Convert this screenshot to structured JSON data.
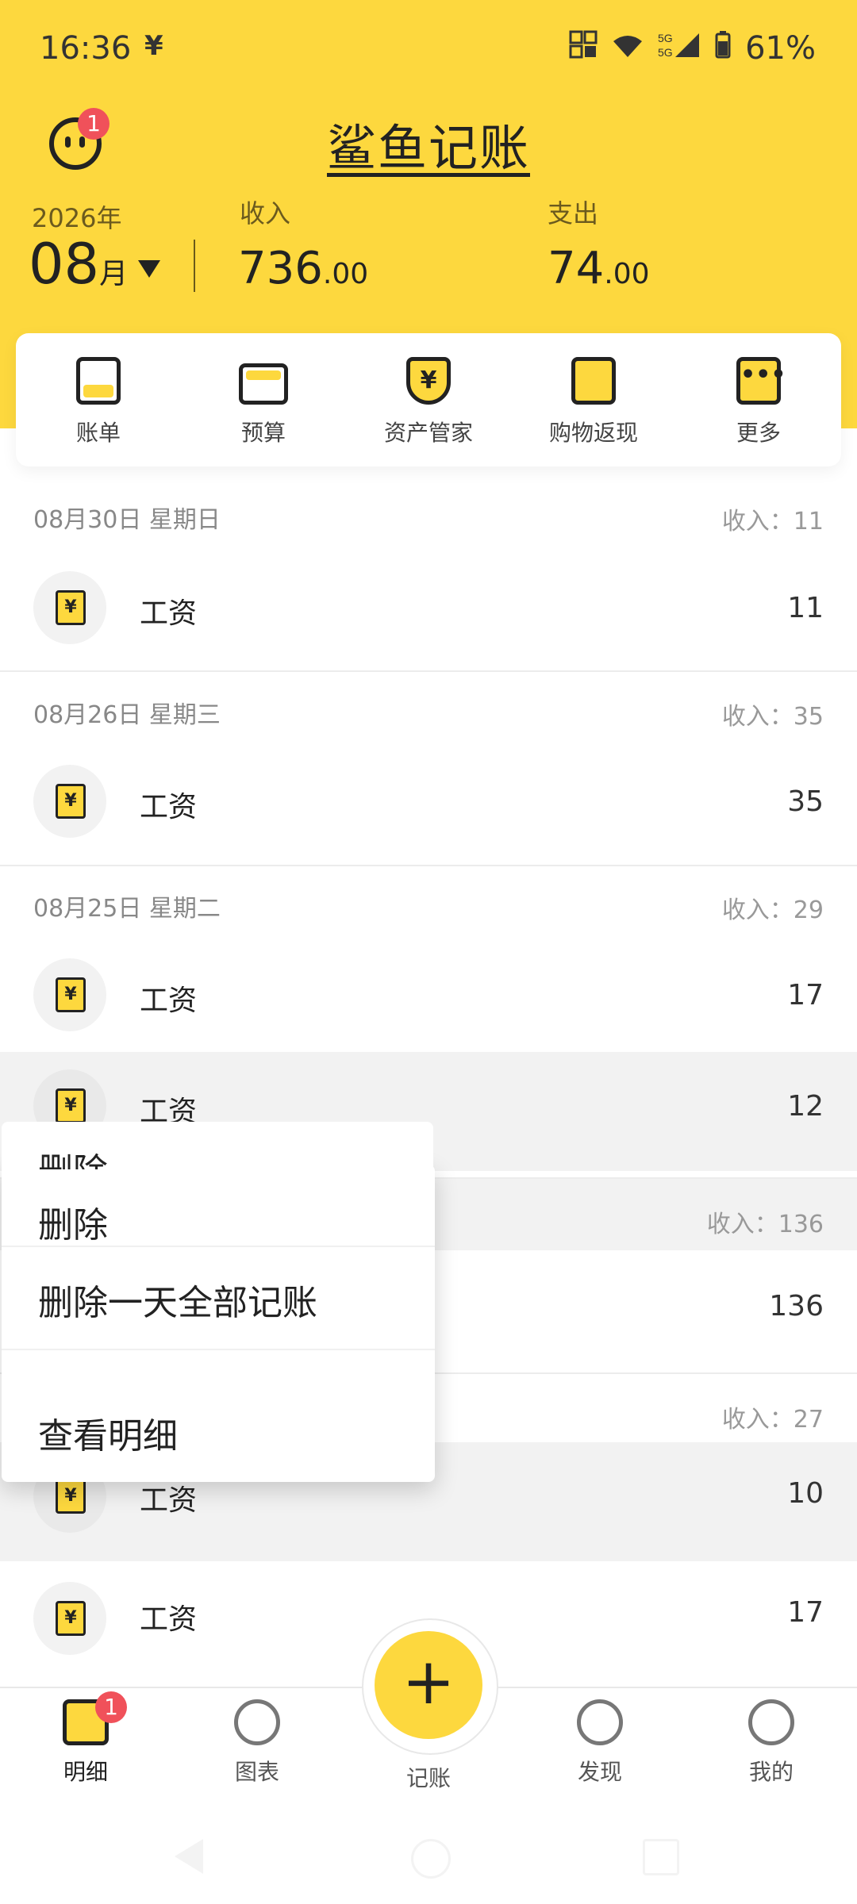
{
  "status_bar": {
    "time": "16:36",
    "yen_icon": "¥",
    "battery": "61%"
  },
  "header": {
    "title": "鲨鱼记账",
    "notification_count": "1",
    "year": "2026年",
    "month": "08",
    "month_suffix": "月",
    "income_label": "收入",
    "income_int": "736",
    "income_dec": ".00",
    "expense_label": "支出",
    "expense_int": "74",
    "expense_dec": ".00"
  },
  "quick_menu": [
    {
      "label": "账单",
      "icon": "bill-icon"
    },
    {
      "label": "预算",
      "icon": "budget-wallet-icon"
    },
    {
      "label": "资产管家",
      "icon": "asset-shield-icon"
    },
    {
      "label": "购物返现",
      "icon": "shopping-bag-icon"
    },
    {
      "label": "更多",
      "icon": "more-dots-icon"
    }
  ],
  "days": [
    {
      "date": "08月30日 星期日",
      "summary": "收入：11",
      "items": [
        {
          "name": "工资",
          "amount": "11"
        }
      ]
    },
    {
      "date": "08月26日 星期三",
      "summary": "收入：35",
      "items": [
        {
          "name": "工资",
          "amount": "35"
        }
      ]
    },
    {
      "date": "08月25日 星期二",
      "summary": "收入：29",
      "items": [
        {
          "name": "工资",
          "amount": "17"
        },
        {
          "name": "工资",
          "amount": "12"
        }
      ]
    },
    {
      "date": "",
      "summary": "收入：136",
      "items": [
        {
          "name": "",
          "amount": "136"
        }
      ]
    },
    {
      "date": "",
      "summary": "收入：27",
      "items": [
        {
          "name": "工资",
          "amount": "10"
        },
        {
          "name": "工资",
          "amount": "17"
        }
      ]
    }
  ],
  "context_menu": {
    "partial_label": "删除",
    "items": [
      "删除",
      "删除一天全部记账",
      "查看明细"
    ]
  },
  "bottom_nav": {
    "items": [
      {
        "label": "明细",
        "icon": "list-detail-icon",
        "badge": "1"
      },
      {
        "label": "图表",
        "icon": "chart-icon"
      },
      {
        "label": "记账",
        "icon": "plus-icon"
      },
      {
        "label": "发现",
        "icon": "planet-icon"
      },
      {
        "label": "我的",
        "icon": "profile-icon"
      }
    ],
    "fab_symbol": "+"
  },
  "colors": {
    "brand_yellow": "#FDD83E",
    "badge_red": "#F0515A"
  }
}
